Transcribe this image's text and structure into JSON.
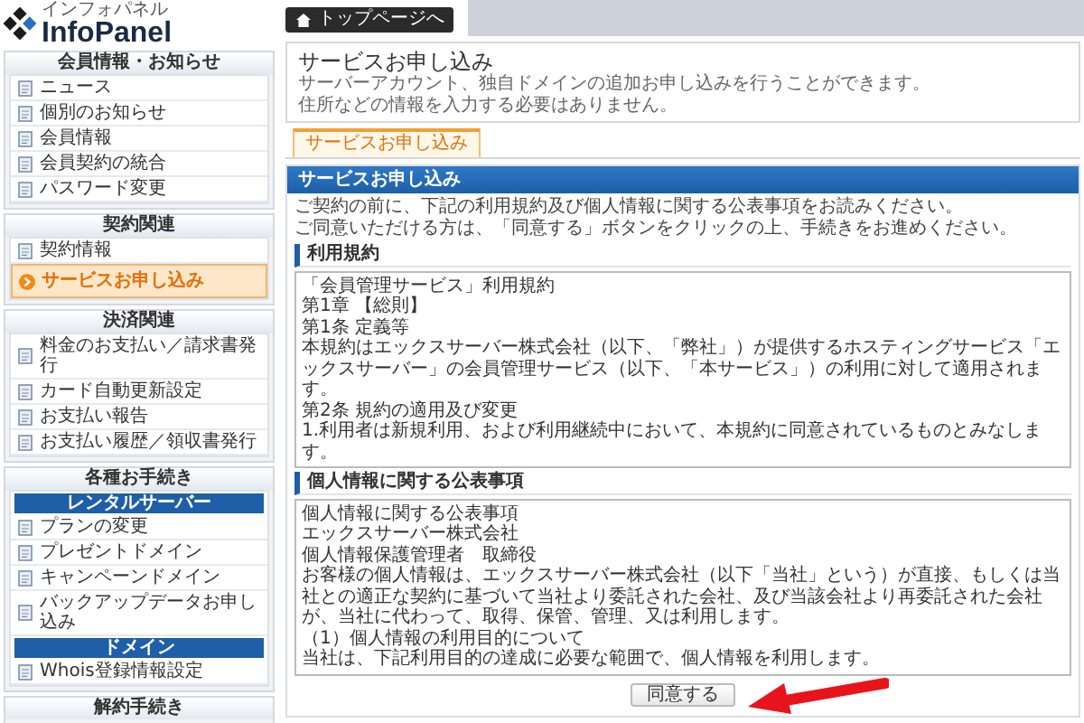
{
  "logo": {
    "kana": "インフォパネル",
    "name": "InfoPanel"
  },
  "sidebar": [
    {
      "title": "会員情報・お知らせ",
      "items": [
        {
          "kind": "link",
          "label": "ニュース",
          "selected": false
        },
        {
          "kind": "link",
          "label": "個別のお知らせ",
          "selected": false
        },
        {
          "kind": "link",
          "label": "会員情報",
          "selected": false
        },
        {
          "kind": "link",
          "label": "会員契約の統合",
          "selected": false
        },
        {
          "kind": "link",
          "label": "パスワード変更",
          "selected": false
        }
      ]
    },
    {
      "title": "契約関連",
      "items": [
        {
          "kind": "link",
          "label": "契約情報",
          "selected": false
        },
        {
          "kind": "link",
          "label": "サービスお申し込み",
          "selected": true
        }
      ]
    },
    {
      "title": "決済関連",
      "items": [
        {
          "kind": "link",
          "label": "料金のお支払い／請求書発行",
          "selected": false
        },
        {
          "kind": "link",
          "label": "カード自動更新設定",
          "selected": false
        },
        {
          "kind": "link",
          "label": "お支払い報告",
          "selected": false
        },
        {
          "kind": "link",
          "label": "お支払い履歴／領収書発行",
          "selected": false
        }
      ]
    },
    {
      "title": "各種お手続き",
      "items": [
        {
          "kind": "subheader",
          "label": "レンタルサーバー"
        },
        {
          "kind": "link",
          "label": "プランの変更",
          "selected": false
        },
        {
          "kind": "link",
          "label": "プレゼントドメイン",
          "selected": false
        },
        {
          "kind": "link",
          "label": "キャンペーンドメイン",
          "selected": false
        },
        {
          "kind": "link",
          "label": "バックアップデータお申し込み",
          "selected": false
        },
        {
          "kind": "subheader",
          "label": "ドメイン"
        },
        {
          "kind": "link",
          "label": "Whois登録情報設定",
          "selected": false
        }
      ]
    },
    {
      "title": "解約手続き"
    }
  ],
  "top_button": "トップページへ",
  "page": {
    "title": "サービスお申し込み",
    "description": [
      "サーバーアカウント、独自ドメインの追加お申し込みを行うことができます。",
      "住所などの情報を入力する必要はありません。"
    ]
  },
  "tabs": [
    {
      "label": "サービスお申し込み",
      "selected": true
    }
  ],
  "panel": {
    "title": "サービスお申し込み",
    "intro": [
      "ご契約の前に、下記の利用規約及び個人情報に関する公表事項をお読みください。",
      "ご同意いただける方は、「同意する」ボタンをクリックの上、手続きをお進めください。"
    ],
    "sections": [
      {
        "heading": "利用規約",
        "lines": [
          "「会員管理サービス」利用規約",
          "第1章 【総則】",
          "第1条 定義等",
          "本規約はエックスサーバー株式会社（以下、「弊社」）が提供するホスティングサービス「エックスサーバー」の会員管理サービス（以下、「本サービス」）の利用に対して適用されます。",
          "第2条 規約の適用及び変更",
          "1.利用者は新規利用、および利用継続中において、本規約に同意されているものとみなします。"
        ]
      },
      {
        "heading": "個人情報に関する公表事項",
        "lines": [
          "個人情報に関する公表事項",
          "エックスサーバー株式会社",
          "個人情報保護管理者　取締役",
          "お客様の個人情報は、エックスサーバー株式会社（以下「当社」という）が直接、もしくは当社との適正な契約に基づいて当社より委託された会社、及び当該会社より再委託された会社が、当社に代わって、取得、保管、管理、又は利用します。",
          "（1）個人情報の利用目的について",
          "当社は、下記利用目的の達成に必要な範囲で、個人情報を利用します。"
        ]
      }
    ],
    "agree_button": "同意する"
  }
}
